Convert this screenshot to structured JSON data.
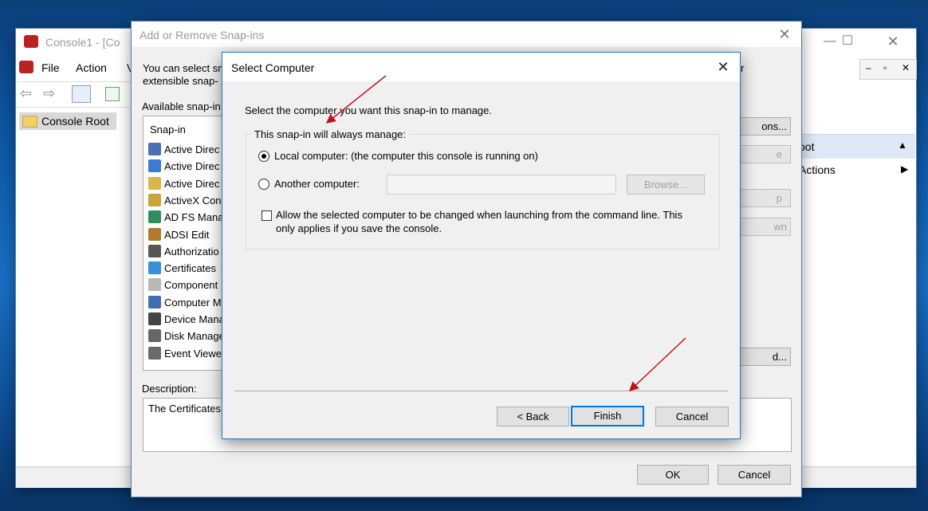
{
  "console": {
    "title": "Console1 - [Co",
    "menu": [
      "File",
      "Action",
      "V"
    ],
    "tree_root": "Console Root",
    "actions_header": "oot",
    "actions_item": "Actions"
  },
  "snapins": {
    "title": "Add or Remove Snap-ins",
    "intro_line1": "You can select sn",
    "intro_line1_right": "r",
    "intro_line2": "extensible snap-",
    "available_label": "Available snap-in",
    "column_header": "Snap-in",
    "items": [
      "Active Direc",
      "Active Direc",
      "Active Direc",
      "ActiveX Con",
      "AD FS Mana",
      "ADSI Edit",
      "Authorizatio",
      "Certificates",
      "Component",
      "Computer M",
      "Device Mana",
      "Disk Manage",
      "Event Viewe"
    ],
    "description_label": "Description:",
    "description_text": "The Certificates",
    "right_buttons": [
      "ons...",
      "e",
      "p",
      "wn",
      "d..."
    ],
    "ok_label": "OK",
    "cancel_label": "Cancel"
  },
  "select_computer": {
    "title": "Select Computer",
    "instruction": "Select the computer you want this snap-in to manage.",
    "group_label": "This snap-in will always manage:",
    "local_label": "Local computer:  (the computer this console is running on)",
    "another_label": "Another computer:",
    "another_value": "",
    "browse_label": "Browse...",
    "allow_line1": "Allow the selected computer to be changed when launching from the command line.  This",
    "allow_line2": "only applies if you save the console.",
    "local_selected": true,
    "allow_checked": false,
    "back_label": "< Back",
    "finish_label": "Finish",
    "cancel_label": "Cancel"
  },
  "colors": {
    "accent": "#0078d7",
    "arrow": "#c0141b",
    "dialog_border": "#1979ca"
  }
}
